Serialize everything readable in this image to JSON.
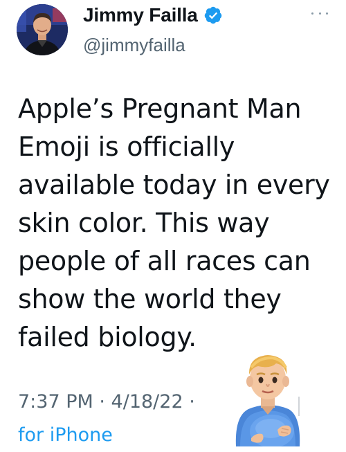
{
  "user": {
    "display_name": "Jimmy Failla",
    "handle": "@jimmyfailla",
    "verified": true,
    "avatar_icon": "profile-photo",
    "verified_icon": "verified-badge-icon",
    "verified_color": "#1d9bf0"
  },
  "menu": {
    "icon": "more-options-icon"
  },
  "tweet": {
    "lines": [
      "Apple’s Pregnant Man",
      "Emoji is officially",
      "available today in every",
      "skin color. This way",
      "people of all races can",
      "show the world they",
      "failed biology."
    ],
    "emoji": "pregnant-man-emoji"
  },
  "meta": {
    "timestamp": "7:37 PM · 4/18/22 ·",
    "source": "for iPhone",
    "source_color": "#1d9bf0"
  }
}
